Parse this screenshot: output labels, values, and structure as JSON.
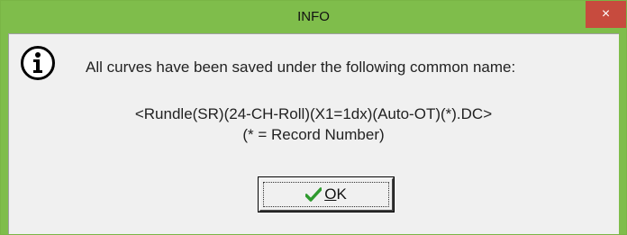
{
  "window": {
    "title": "INFO",
    "close_glyph": "×"
  },
  "message": {
    "line1": "All curves have been saved under the following common name:",
    "line2": "<Rundle(SR)(24-CH-Roll)(X1=1dx)(Auto-OT)(*).DC>",
    "line3": "(* = Record Number)"
  },
  "buttons": {
    "ok_mnemonic": "O",
    "ok_rest": "K"
  },
  "icons": {
    "info": "info-icon",
    "check": "check-icon"
  },
  "colors": {
    "titlebar": "#7fbd4b",
    "close": "#c74b3e",
    "check": "#2e9a2e"
  }
}
